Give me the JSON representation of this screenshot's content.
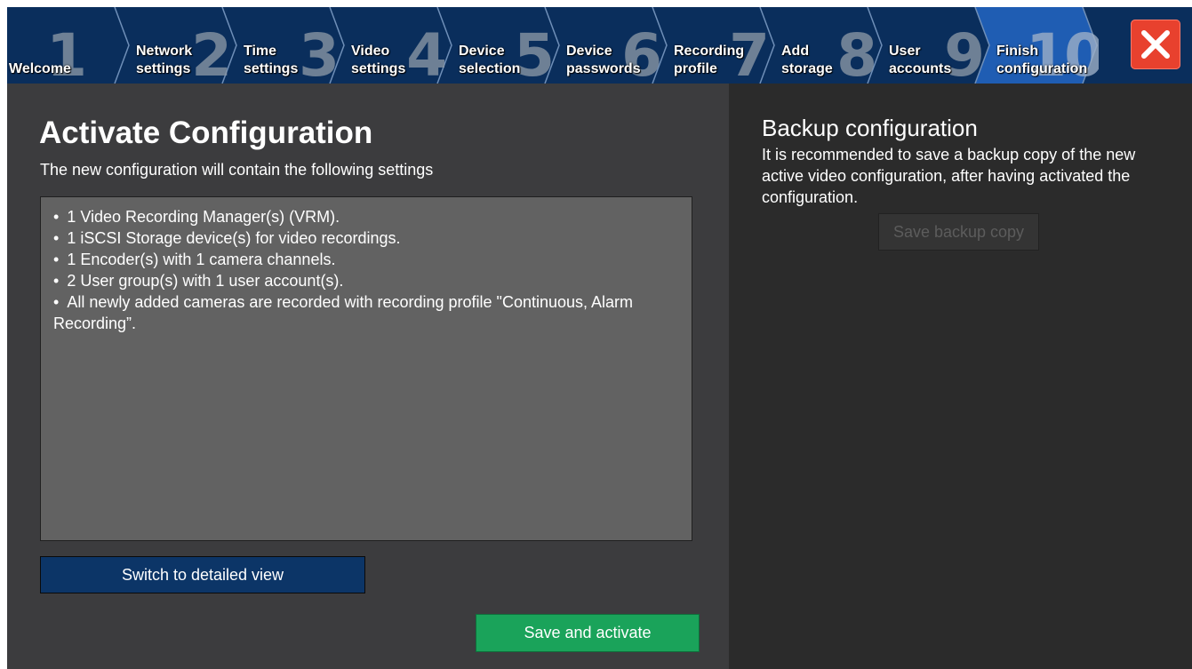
{
  "wizard": {
    "steps": [
      {
        "number": "1",
        "label": "Welcome"
      },
      {
        "number": "2",
        "label": "Network\nsettings"
      },
      {
        "number": "3",
        "label": "Time\nsettings"
      },
      {
        "number": "4",
        "label": "Video\nsettings"
      },
      {
        "number": "5",
        "label": "Device\nselection"
      },
      {
        "number": "6",
        "label": "Device\npasswords"
      },
      {
        "number": "7",
        "label": "Recording\nprofile"
      },
      {
        "number": "8",
        "label": "Add\nstorage"
      },
      {
        "number": "9",
        "label": "User\naccounts"
      },
      {
        "number": "10",
        "label": "Finish\nconfiguration"
      }
    ],
    "active_step": 10,
    "colors": {
      "bar": "#0a2e5c",
      "active": "#1f5db3",
      "close": "#e8412e"
    }
  },
  "main": {
    "title": "Activate Configuration",
    "subtitle": "The new configuration will contain the following settings",
    "summary": [
      "1 Video Recording Manager(s) (VRM).",
      "1 iSCSI Storage device(s) for video recordings.",
      "1 Encoder(s) with 1 camera channels.",
      "2 User group(s) with 1 user account(s).",
      "All newly added cameras are recorded with recording profile \"Continuous, Alarm Recording”."
    ],
    "detail_button": "Switch to detailed view",
    "activate_button": "Save and activate"
  },
  "backup": {
    "title": "Backup configuration",
    "description": "It is recommended to save a backup copy of the new active video configuration, after having activated the configuration.",
    "button": "Save backup copy"
  }
}
